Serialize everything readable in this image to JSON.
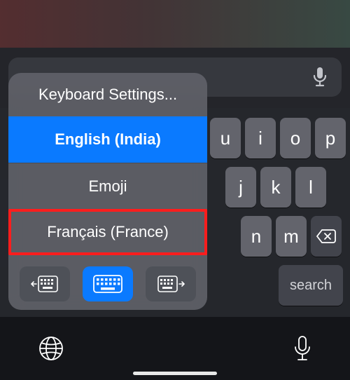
{
  "popup": {
    "settings_label": "Keyboard Settings...",
    "items": [
      {
        "label": "English (India)"
      },
      {
        "label": "Emoji"
      },
      {
        "label": "Français (France)"
      }
    ],
    "selected_index": 0,
    "highlighted_index": 2
  },
  "keyboard": {
    "rows": {
      "r1": [
        "u",
        "i",
        "o",
        "p"
      ],
      "r2": [
        "j",
        "k",
        "l"
      ],
      "r3": [
        "n",
        "m"
      ]
    },
    "search_label": "search"
  },
  "icons": {
    "mic": "mic-icon",
    "globe": "globe-icon",
    "delete": "delete-icon",
    "kbd_left": "keyboard-dock-left-icon",
    "kbd_center": "keyboard-standard-icon",
    "kbd_right": "keyboard-dock-right-icon"
  },
  "colors": {
    "accent": "#0a7aff",
    "highlight": "#ff1d1d"
  }
}
